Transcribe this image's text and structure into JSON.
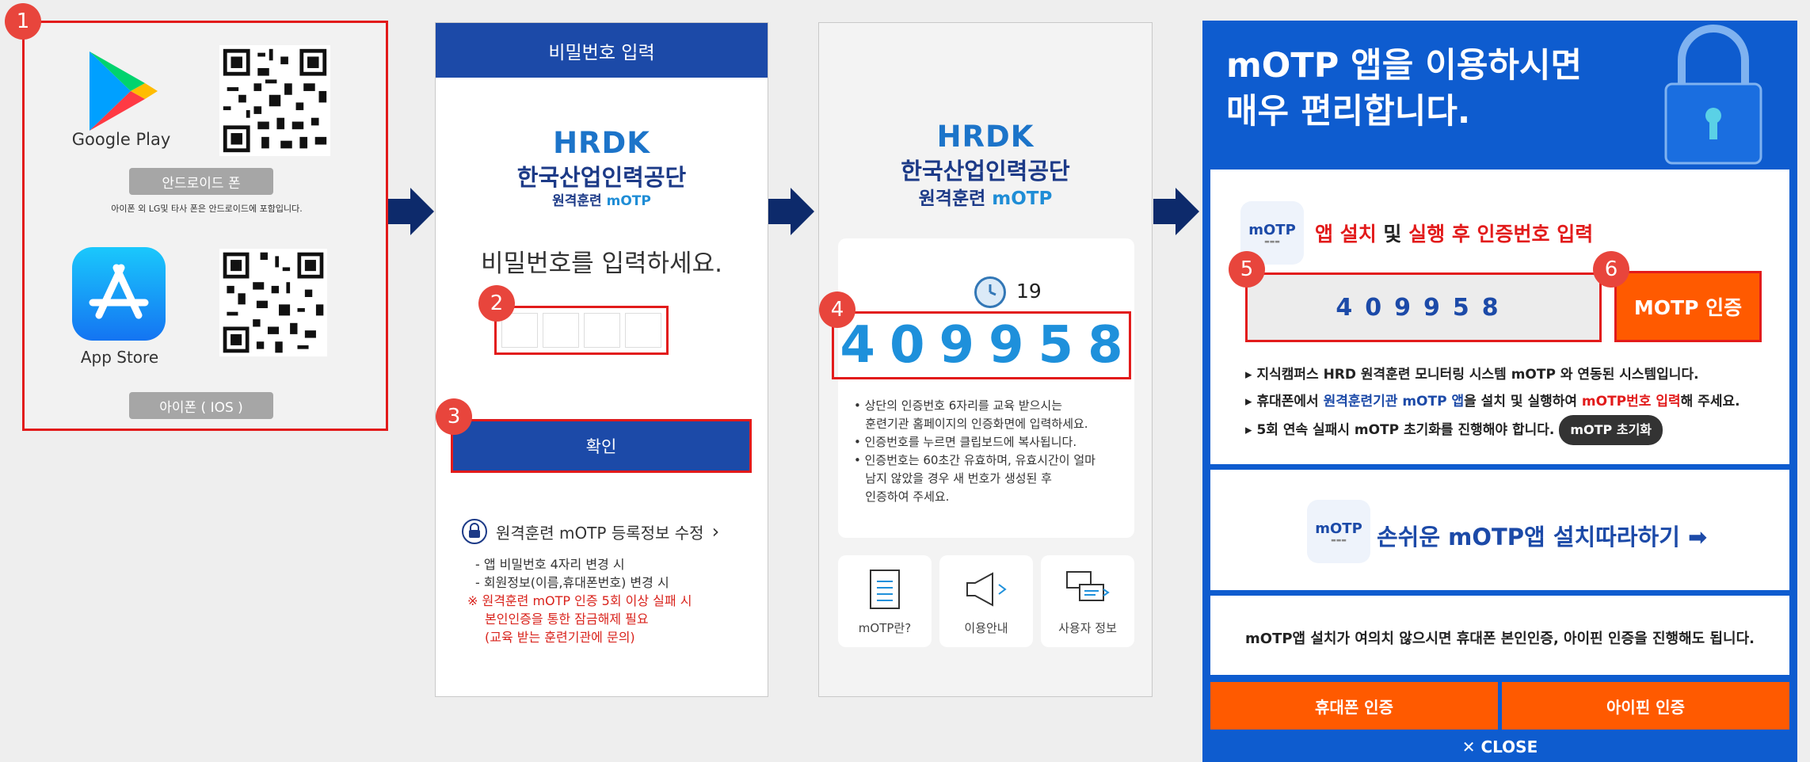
{
  "badges": [
    "1",
    "2",
    "3",
    "4",
    "5",
    "6"
  ],
  "step1": {
    "google_play": "Google Play",
    "android_label": "안드로이드 폰",
    "android_note": "아이폰 외 LG및 타사 폰은 안드로이드에 포함입니다.",
    "app_store": "App Store",
    "ios_label": "아이폰 ( IOS )"
  },
  "step2": {
    "header": "비밀번호 입력",
    "logo": "HRDK",
    "org_name": "한국산업인력공단",
    "sub_prefix": "원격훈련",
    "sub_brand": "mOTP",
    "prompt": "비밀번호를 입력하세요.",
    "confirm": "확인",
    "edit_link": "원격훈련 mOTP 등록정보 수정",
    "edit_items": [
      "- 앱 비밀번호 4자리 변경 시",
      "- 회원정보(이름,휴대폰번호) 변경 시"
    ],
    "warning_1": "※ 원격훈련 mOTP 인증 5회 이상 실패 시",
    "warning_2": "본인인증을 통한 잠금해제 필요",
    "warning_3": "(교육 받는 훈련기관에 문의)"
  },
  "step3": {
    "logo": "HRDK",
    "org_name": "한국산업인력공단",
    "sub_prefix": "원격훈련",
    "sub_brand": "mOTP",
    "countdown": "19",
    "otp": "409958",
    "notes": [
      "• 상단의 인증번호 6자리를 교육 받으시는",
      "   훈련기관 홈페이지의 인증화면에 입력하세요.",
      "• 인증번호를 누르면 클립보드에 복사됩니다.",
      "• 인증번호는 60초간 유효하며, 유효시간이 얼마",
      "   남지 않았을 경우 새 번호가 생성된 후",
      "   인증하여 주세요."
    ],
    "tiles": [
      "mOTP란?",
      "이용안내",
      "사용자 정보"
    ]
  },
  "step4": {
    "title_line1": "mOTP 앱을 이용하시면",
    "title_line2": "매우 편리합니다.",
    "logo_text": "mOTP",
    "install_title_a": "앱 설치",
    "install_title_b": " 및 ",
    "install_title_c": "실행 후 인증번호 입력",
    "otp_value": "409958",
    "auth_button": "MOTP 인증",
    "bullet1": "▸ 지식캠퍼스 HRD 원격훈련 모니터링 시스템 mOTP 와 연동된 시스템입니다.",
    "bullet2_a": "▸ 휴대폰에서 ",
    "bullet2_b": "원격훈련기관 mOTP 앱",
    "bullet2_c": "을 설치 및 실행하여 ",
    "bullet2_d": "mOTP번호 입력",
    "bullet2_e": "해 주세요.",
    "bullet3": "▸ 5회 연속 실패시 mOTP 초기화를 진행해야 합니다.",
    "reset_button": "mOTP 초기화",
    "install_link": "손쉬운 mOTP앱 설치따라하기 ➡",
    "alt_note": "mOTP앱 설치가 여의치 않으시면 휴대폰 본인인증, 아이핀 인증을 진행해도 됩니다.",
    "phone_auth": "휴대폰 인증",
    "ipin_auth": "아이핀 인증",
    "close": "✕ CLOSE"
  },
  "colors": {
    "accent_blue": "#1c4aa8",
    "highlight_red": "#e21b1b",
    "orange": "#ff5a00",
    "otp_blue": "#1e90db"
  }
}
